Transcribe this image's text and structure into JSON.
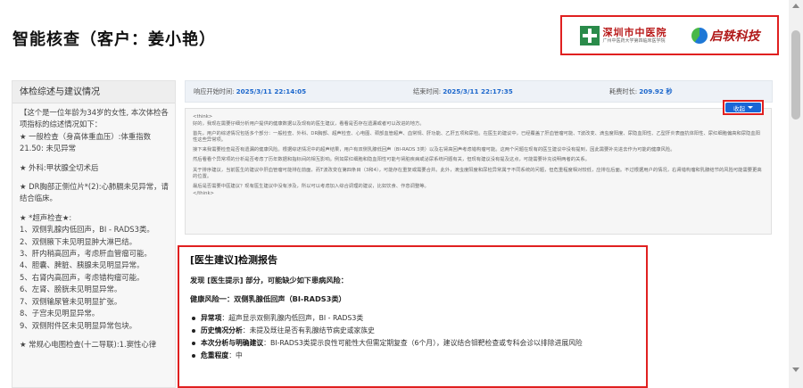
{
  "header": {
    "title": "智能核查（客户：姜小艳）",
    "hospital_name": "深圳市中医院",
    "hospital_subtitle": "广州中医药大学第四临床医学院",
    "brand_name": "启轶科技",
    "hospital_emblem": "cross-emblem",
    "brand_mark": "circle-logo"
  },
  "left_panel": {
    "title": "体检综述与建议情况",
    "paragraphs": [
      "【这个是一位年龄为34岁的女性, 本次体检各项指标的综述情况如下：",
      "★ 一般检查（身高体重血压）:体重指数21.50: 未见异常",
      "★ 外科:甲状腺全切术后",
      "★ DR胸部正侧位片*(2):心肺膈未见异常，请结合临床。",
      "★ *超声检查★:\n1、双侧乳腺内低回声，BI - RADS3类。\n2、双侧腋下未见明显肿大淋巴结。\n3、肝内稍高回声，考虑肝血管瘤可能。\n4、胆囊、脾脏、胰腺未见明显异常。\n5、右肾内高回声，考虑错构瘤可能。\n6、左肾、膀胱未见明显异常。\n7、双侧输尿管未见明显扩张。\n8、子宫未见明显异常。\n9、双侧附件区未见明显异常包块。",
      "★ 常规心电图检查(十二导联):1.窦性心律"
    ]
  },
  "time_bar": {
    "start_label": "响应开始时间:",
    "start_value": "2025/3/11 22:14:05",
    "end_label": "结束时间:",
    "end_value": "2025/3/11 22:17:35",
    "duration_label": "耗费时长:",
    "duration_value": "209.92 秒"
  },
  "think": {
    "open_tag": "<think>",
    "close_tag": "</think>",
    "paragraphs": [
      "好的，我现在需要仔细分析用户提供的健康数据以及现有的医生建议，看看是否存在遗漏或者可以改进的地方。",
      "首先，用户的综述情况包括多个部分：一般检查、外科、DR胸部、超声检查、心电图、颈部血管超声、血常规、肝功能、乙肝五项和尿检。在医生的建议中，已经覆盖了肝血管瘤可能、T波改变、滴虫度阳度、尿隐血阳性、乙型肝炎表面抗体阳性、尿红细胞偏高和尿隐血阳性这些异常项。",
      "接下来我需要检查是否有遗漏的健康风险。根据综述情况中的超声结果，用户有双侧乳腺低回声（BI-RADS 3类）以及右肾高回声考虑错构瘤可能。这两个问题在现有的医生建议中没有提到，因此需要补充进去作为可能的健康风险。",
      "然后看看个异常项的分析是否考虑了历年数据和指标间的相互影响。例如尿红细胞和隐血阳性可能与肾脏疾病或泌尿系统问题有关，但现有建议没有提及这点，可能需要补充说明两者的关系。",
      "关于排序建议，当前医生的建议中肝血管瘤可能排在前面，而T波改变在第四条目（3和4），可能存在重复或需要合并。此外，滴虫度阳度和尿检异常属于不同系统的问题，但危重程度相对较低，应排在后面。不过根据用户的情况，右肾错构瘤和乳腺结节的风险可能需要更高的位置。",
      "最后是否需要中医建议？现有医生建议中没有涉及，所以可以考虑加入综合调理的建议，比如饮食、作息调整等。"
    ],
    "collapse_label": "收起"
  },
  "report": {
    "title": "[医生建议]检测报告",
    "intro": "发现 [医生提示] 部分，可能缺少如下患病风险：",
    "risk_title": "健康风险一：双侧乳腺低回声（BI-RADS3类）",
    "items": [
      {
        "label": "异常项",
        "text": "：超声显示双侧乳腺内低回声，BI - RADS3类"
      },
      {
        "label": "历史情况分析",
        "text": "：未提及既往是否有乳腺结节病史或家族史"
      },
      {
        "label": "本次分析与明确建议",
        "text": "：BI-RADS3类提示良性可能性大但需定期复查（6个月），建议结合钼靶检查或专科会诊以排除进展风险"
      },
      {
        "label": "危重程度",
        "text": "：中"
      }
    ]
  },
  "colors": {
    "accent_blue": "#1a66d6",
    "highlight_red": "#e02020",
    "time_blue": "#1a66cc"
  }
}
